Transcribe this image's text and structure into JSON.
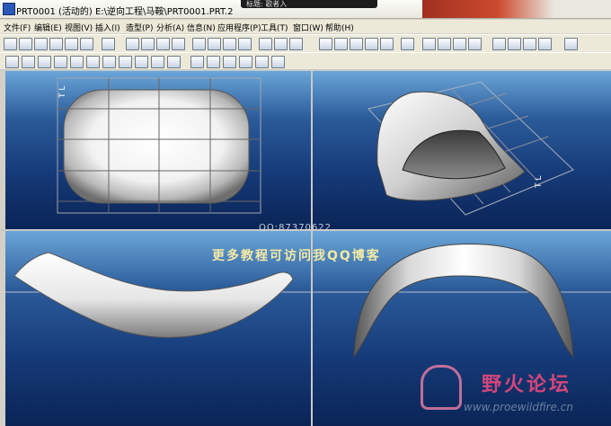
{
  "window": {
    "title": "PRT0001 (活动的) E:\\逆向工程\\马鞍\\PRT0001.PRT.2",
    "media_label": "标题: 歌者入"
  },
  "menu": [
    "文件(F)",
    "编辑(E)",
    "视图(V)",
    "插入(I)",
    "造型(P)",
    "分析(A)",
    "信息(N)",
    "应用程序(P)",
    "工具(T)",
    "窗口(W)",
    "帮助(H)"
  ],
  "viewports": {
    "top_left": {
      "axis_label": "T L"
    },
    "top_right": {
      "axis_label": "T L"
    }
  },
  "watermarks": {
    "qq": "QQ:87370622",
    "promo": "更多教程可访问我QQ博客",
    "logo_text": "野火论坛",
    "url": "www.proewildfire.cn"
  },
  "colors": {
    "viewport_top": "#6aa6d8",
    "viewport_bottom": "#0a2456",
    "promo_text": "#f4e9a4",
    "logo_text": "#d4477a"
  }
}
